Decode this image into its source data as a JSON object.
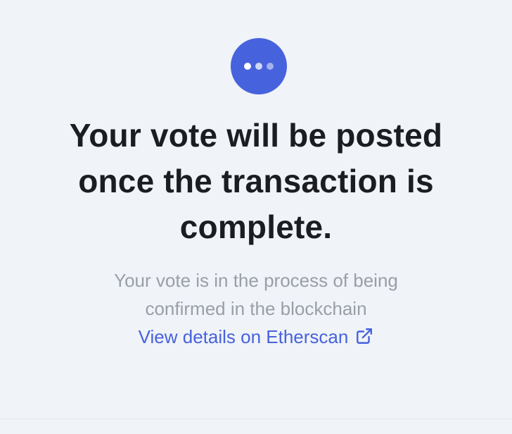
{
  "status": {
    "icon": "loading-dots-icon",
    "accent_color": "#4762dd"
  },
  "heading": {
    "line1": "Your vote will be posted",
    "line2": "once the transaction is",
    "line3": "complete."
  },
  "description": {
    "line1": "Your vote is in the process of being",
    "line2": "confirmed in the blockchain"
  },
  "etherscan_link": {
    "label": "View details on Etherscan",
    "icon": "external-link-icon"
  }
}
